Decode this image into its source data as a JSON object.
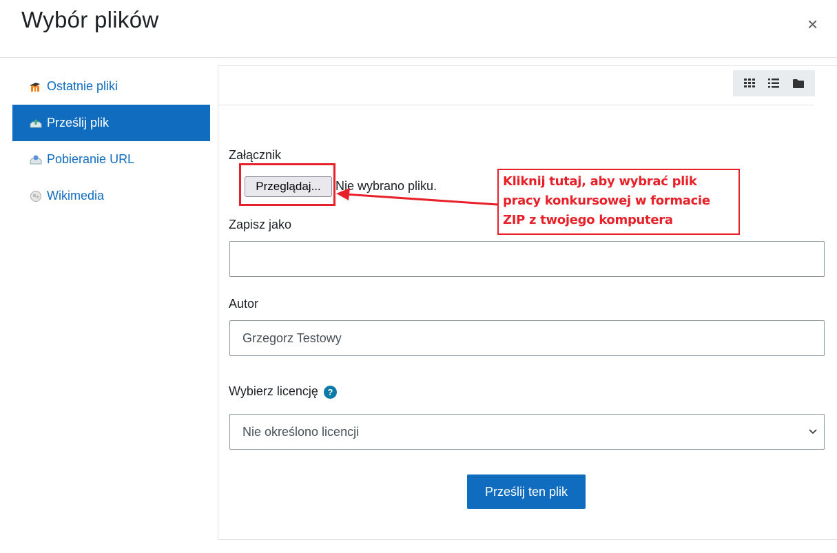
{
  "dialog": {
    "title": "Wybór plików",
    "close_label": "×"
  },
  "sidebar": {
    "items": [
      {
        "label": "Ostatnie pliki",
        "icon": "moodle-icon",
        "active": false
      },
      {
        "label": "Prześlij plik",
        "icon": "upload-icon",
        "active": true
      },
      {
        "label": "Pobieranie URL",
        "icon": "url-download-icon",
        "active": false
      },
      {
        "label": "Wikimedia",
        "icon": "wikimedia-icon",
        "active": false
      }
    ]
  },
  "viewbar": {
    "icons": [
      "grid-view-icon",
      "list-view-icon",
      "folder-view-icon"
    ]
  },
  "form": {
    "attachment_label": "Załącznik",
    "browse_label": "Przeglądaj...",
    "no_file_text": "Nie wybrano pliku.",
    "save_as_label": "Zapisz jako",
    "save_as_value": "",
    "author_label": "Autor",
    "author_value": "Grzegorz Testowy",
    "license_label": "Wybierz licencję",
    "license_help": "?",
    "license_value": "Nie określono licencji",
    "submit_label": "Prześlij ten plik"
  },
  "annotation": {
    "line1": "Kliknij tutaj, aby wybrać plik",
    "line2": "pracy konkursowej w formacie",
    "line3": "ZIP z twojego komputera",
    "color": "#e8202a"
  },
  "colors": {
    "accent": "#0f6cbf",
    "border": "#dee2e6"
  }
}
